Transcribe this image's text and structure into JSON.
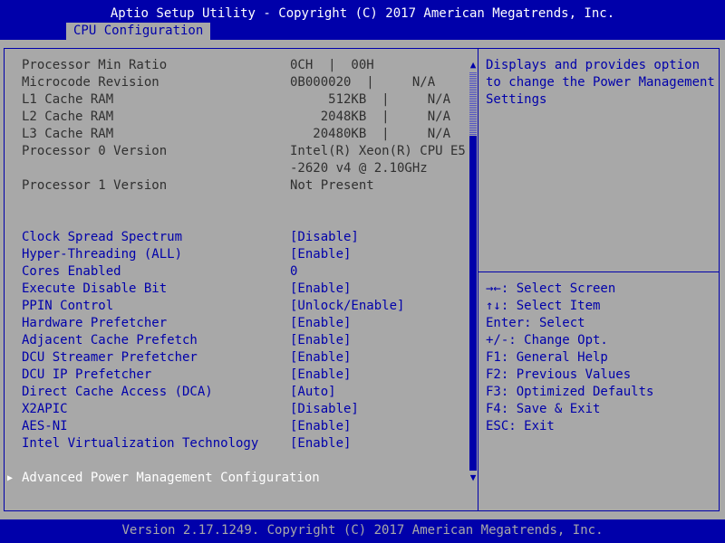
{
  "header": {
    "title": "Aptio Setup Utility - Copyright (C) 2017 American Megatrends, Inc.",
    "tab": "CPU Configuration"
  },
  "info_rows": [
    {
      "label": "Processor Min Ratio",
      "value": "0CH  |  00H"
    },
    {
      "label": "Microcode Revision",
      "value": "0B000020  |     N/A"
    },
    {
      "label": "L1 Cache RAM",
      "value": "     512KB  |     N/A"
    },
    {
      "label": "L2 Cache RAM",
      "value": "    2048KB  |     N/A"
    },
    {
      "label": "L3 Cache RAM",
      "value": "   20480KB  |     N/A"
    },
    {
      "label": "Processor 0 Version",
      "value": "Intel(R) Xeon(R) CPU E5"
    },
    {
      "label": "",
      "value": "-2620 v4 @ 2.10GHz"
    },
    {
      "label": "Processor 1 Version",
      "value": "Not Present"
    }
  ],
  "settings": [
    {
      "label": "Clock Spread Spectrum",
      "value": "[Disable]"
    },
    {
      "label": "Hyper-Threading (ALL)",
      "value": "[Enable]"
    },
    {
      "label": "Cores Enabled",
      "value": "0"
    },
    {
      "label": "Execute Disable Bit",
      "value": "[Enable]"
    },
    {
      "label": "PPIN Control",
      "value": "[Unlock/Enable]"
    },
    {
      "label": "Hardware Prefetcher",
      "value": "[Enable]"
    },
    {
      "label": "Adjacent Cache Prefetch",
      "value": "[Enable]"
    },
    {
      "label": "DCU Streamer Prefetcher",
      "value": "[Enable]"
    },
    {
      "label": "DCU IP Prefetcher",
      "value": "[Enable]"
    },
    {
      "label": "Direct Cache Access (DCA)",
      "value": "[Auto]"
    },
    {
      "label": "X2APIC",
      "value": "[Disable]"
    },
    {
      "label": "AES-NI",
      "value": "[Enable]"
    },
    {
      "label": "Intel Virtualization Technology",
      "value": "[Enable]"
    }
  ],
  "submenu": {
    "label": "Advanced Power Management Configuration"
  },
  "help": {
    "lines": [
      "Displays and provides option",
      "to change the Power Management",
      "Settings"
    ]
  },
  "keys": [
    "→←: Select Screen",
    "↑↓: Select Item",
    "Enter: Select",
    "+/-: Change Opt.",
    "F1: General Help",
    "F2: Previous Values",
    "F3: Optimized Defaults",
    "F4: Save & Exit",
    "ESC: Exit"
  ],
  "footer": {
    "version": "Version 2.17.1249. Copyright (C) 2017 American Megatrends, Inc."
  },
  "colors": {
    "background": "#0000aa",
    "panel": "#a8a8a8",
    "selectable_text": "#0000aa",
    "static_text": "#303030",
    "highlight_text": "#ffffff"
  },
  "icons": {
    "submenu_marker": "submenu-arrow-icon",
    "scroll_up": "scroll-up-icon",
    "scroll_down": "scroll-down-icon"
  }
}
